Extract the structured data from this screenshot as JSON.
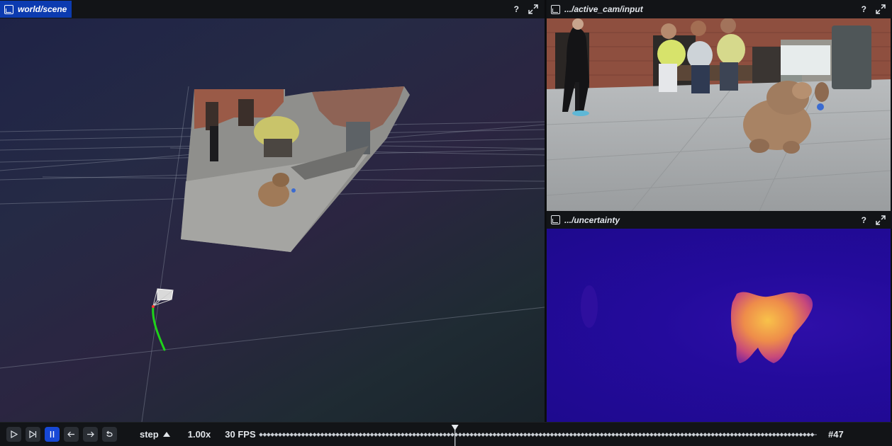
{
  "panels": {
    "scene": {
      "title": "world/scene",
      "help": "?"
    },
    "input": {
      "title": ".../active_cam/input",
      "help": "?"
    },
    "uncertainty": {
      "title": ".../uncertainty",
      "help": "?"
    }
  },
  "icons": {
    "view3d": "view-3d-icon",
    "view2d": "view-2d-icon",
    "maximize": "maximize-icon",
    "play": "play-icon",
    "step_end": "skip-to-end-icon",
    "pause": "pause-icon",
    "prev": "arrow-left-icon",
    "next": "arrow-right-icon",
    "loop": "loop-icon"
  },
  "colors": {
    "accent": "#1748d6",
    "trajectory": "#1fd21a",
    "header_active": "#0c3bb0"
  },
  "timeline": {
    "mode": "step",
    "speed": "1.00x",
    "fps": "30 FPS",
    "frame": "#47",
    "position": 0.35
  }
}
